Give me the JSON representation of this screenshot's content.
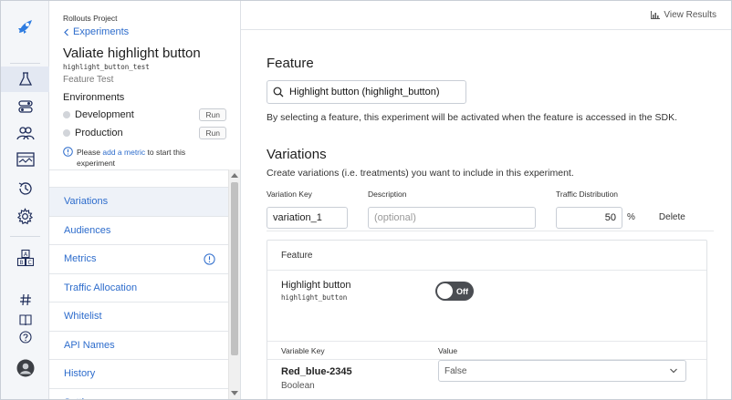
{
  "sidebar": {
    "project": "Rollouts Project",
    "back_label": "Experiments",
    "title": "Valiate highlight button",
    "key": "highlight_button_test",
    "type": "Feature Test",
    "environments_heading": "Environments",
    "environments": [
      {
        "name": "Development",
        "action": "Run"
      },
      {
        "name": "Production",
        "action": "Run"
      }
    ],
    "note_prefix": "Please",
    "note_link": "add a metric",
    "note_suffix": "to start this experiment",
    "nav": [
      "Variations",
      "Audiences",
      "Metrics",
      "Traffic Allocation",
      "Whitelist",
      "API Names",
      "History",
      "Settings"
    ]
  },
  "topbar": {
    "view_results": "View Results"
  },
  "feature": {
    "heading": "Feature",
    "search_value": "Highlight button (highlight_button)",
    "description": "By selecting a feature, this experiment will be activated when the feature is accessed in the SDK."
  },
  "variations": {
    "heading": "Variations",
    "description": "Create variations (i.e. treatments) you want to include in this experiment.",
    "col_key": "Variation Key",
    "col_desc": "Description",
    "col_traffic": "Traffic Distribution",
    "row": {
      "key": "variation_1",
      "desc_placeholder": "(optional)",
      "traffic": "50",
      "pct": "%",
      "delete": "Delete"
    }
  },
  "panel": {
    "section_heading": "Feature",
    "feature_name": "Highlight button",
    "feature_key": "highlight_button",
    "toggle_label": "Off",
    "col_var_key": "Variable Key",
    "col_value": "Value",
    "var_name": "Red_blue-2345",
    "var_type": "Boolean",
    "var_value": "False"
  },
  "colors": {
    "accent": "#2d6ccc",
    "toggle_off": "#4a4d52",
    "rail_icon": "#1f2d5a"
  }
}
